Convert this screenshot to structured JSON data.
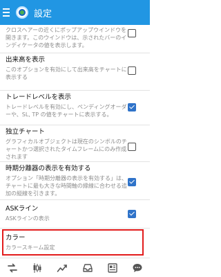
{
  "header": {
    "title": "設定"
  },
  "items": [
    {
      "title": "",
      "desc": "クロスヘアーの近くにポップアップウインドウを開きます。このウインドウは、示されたバーのインディケータの値を表示します。",
      "checked": false
    },
    {
      "title": "出来高を表示",
      "desc": "このオプションを有効にして出来高をチャートに表示する",
      "checked": false
    },
    {
      "title": "トレードレベルを表示",
      "desc": "トレードレベルを有効にし、ペンディングオーダーや、SL, TP の値をチャートに表示する。",
      "checked": true
    },
    {
      "title": "独立チャート",
      "desc": "グラフィカルオブジェクトは現在のシンボルのチャートかつ選択されたタイムフレームにのみ作成されます",
      "checked": false
    },
    {
      "title": "時期分離器の表示を有効する",
      "desc": "オプション「時期分離器の表示を有効する」は、チャートに最も大きな時間軸の縁線に合わせる追加の縦線を引きます。",
      "checked": true
    },
    {
      "title": "ASKライン",
      "desc": "ASKラインの表示",
      "checked": true
    },
    {
      "title": "カラー",
      "desc": "カラースキーム設定",
      "checked": null
    }
  ],
  "bottom_nav": [
    "quotes-icon",
    "chart-icon",
    "trade-icon",
    "history-icon",
    "news-icon",
    "chat-icon"
  ],
  "colors": {
    "header_bg": "#2196e3",
    "checkbox_on": "#2f73c9",
    "highlight": "#e21b1b"
  }
}
